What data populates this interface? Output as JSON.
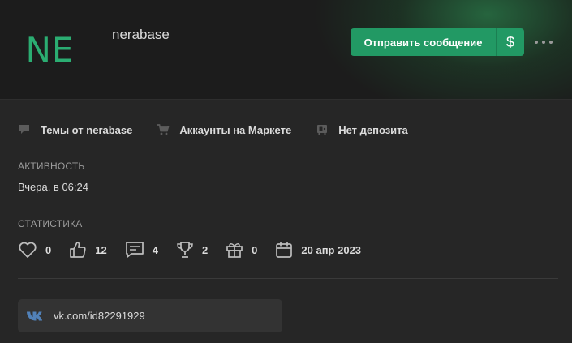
{
  "profile": {
    "avatar_initials": "NE",
    "username": "nerabase",
    "send_message_label": "Отправить сообщение",
    "money_symbol": "$"
  },
  "links": {
    "themes": "Темы от nerabase",
    "market": "Аккаунты на Маркете",
    "deposit": "Нет депозита"
  },
  "activity": {
    "title": "АКТИВНОСТЬ",
    "value": "Вчера, в 06:24"
  },
  "stats": {
    "title": "СТАТИСТИКА",
    "likes": "0",
    "thumbs": "12",
    "messages": "4",
    "trophies": "2",
    "gifts": "0",
    "registered": "20 апр 2023"
  },
  "contacts": {
    "vk": "vk.com/id82291929"
  },
  "colors": {
    "accent": "#229964",
    "avatar_text": "#2bad72",
    "vk_icon": "#5181b8"
  }
}
